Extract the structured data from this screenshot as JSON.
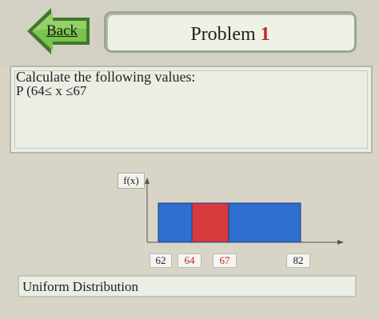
{
  "nav": {
    "back_label": "Back"
  },
  "header": {
    "title": "Problem",
    "number": "1"
  },
  "question": {
    "prompt": "Calculate the following values:",
    "expression": "P (64≤ x ≤67"
  },
  "chart_data": {
    "type": "bar",
    "ylabel": "f(x)",
    "x_ticks": [
      "62",
      "64",
      "67",
      "82"
    ],
    "segments": [
      {
        "from": 62,
        "to": 64,
        "color": "#2e6fcf"
      },
      {
        "from": 64,
        "to": 67,
        "color": "#d8393d"
      },
      {
        "from": 67,
        "to": 82,
        "color": "#2e6fcf"
      }
    ],
    "highlight_tick_color": "#c0262d",
    "normal_tick_color": "#222222"
  },
  "footer": {
    "label": "Uniform Distribution"
  }
}
